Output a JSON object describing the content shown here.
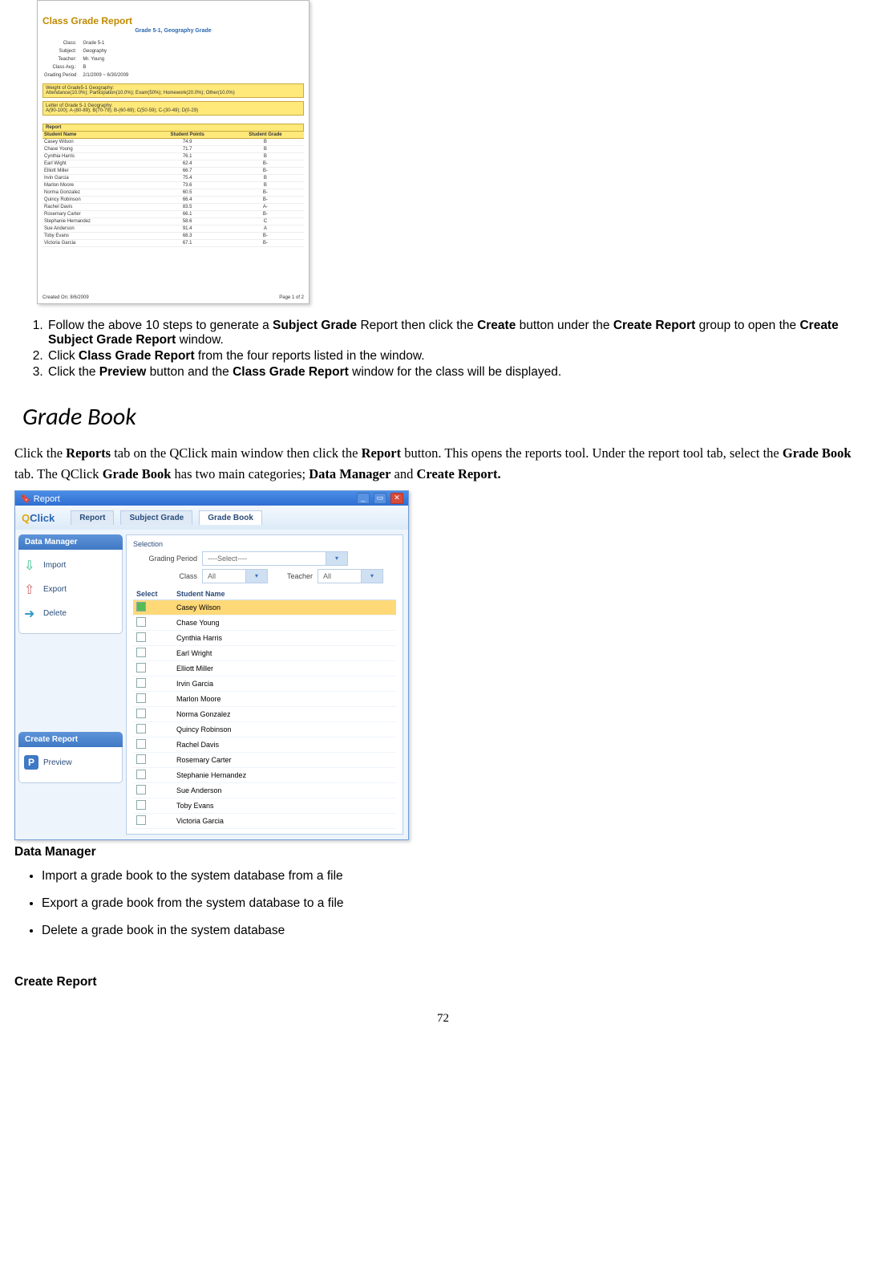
{
  "report": {
    "title": "Class Grade Report",
    "subtitle": "Grade 5-1, Geography Grade",
    "info": {
      "class_label": "Class:",
      "class_value": "Grade 5-1",
      "subject_label": "Subject:",
      "subject_value": "Geography",
      "teacher_label": "Teacher:",
      "teacher_value": "Mr. Young",
      "classavg_label": "Class Avg.:",
      "classavg_value": "B",
      "period_label": "Grading Period",
      "period_value": "2/1/2009 ~ 6/30/2009"
    },
    "weight_header": "Weight of Grade5-1 Geography:",
    "weight_text": "Attendance(10.0%); Participation(10.0%); Exam(50%); Homework(20.0%); Other(10.0%)",
    "letter_header": "Letter of Grade 5-1 Geography:",
    "letter_text": "A(90-100); A-(80-89); B(70-79); B-(60-69); C(50-59); C-(30-49); D(0-29)",
    "section_hdr": "Report",
    "cols": {
      "name": "Student Name",
      "points": "Student  Points",
      "grade": "Student Grade"
    },
    "rows": [
      {
        "name": "Casey Wilson",
        "points": "74.9",
        "grade": "B"
      },
      {
        "name": "Chase Young",
        "points": "71.7",
        "grade": "B"
      },
      {
        "name": "Cynthia Harris",
        "points": "76.1",
        "grade": "B"
      },
      {
        "name": "Earl Wight",
        "points": "62.4",
        "grade": "B-"
      },
      {
        "name": "Elliott Miller",
        "points": "66.7",
        "grade": "B-"
      },
      {
        "name": "Irvin Garcia",
        "points": "75.4",
        "grade": "B"
      },
      {
        "name": "Marlon Moore",
        "points": "73.6",
        "grade": "B"
      },
      {
        "name": "Norma Gonzalez",
        "points": "60.5",
        "grade": "B-"
      },
      {
        "name": "Quincy Robinson",
        "points": "66.4",
        "grade": "B-"
      },
      {
        "name": "Rachel Davis",
        "points": "83.5",
        "grade": "A-"
      },
      {
        "name": "Rosemary Carter",
        "points": "66.1",
        "grade": "B-"
      },
      {
        "name": "Stephanie Hernandez",
        "points": "58.6",
        "grade": "C"
      },
      {
        "name": "Sue Anderson",
        "points": "91.4",
        "grade": "A"
      },
      {
        "name": "Toby Evans",
        "points": "68.3",
        "grade": "B-"
      },
      {
        "name": "Victoria Garcia",
        "points": "67.1",
        "grade": "B-"
      }
    ],
    "created": "Created On:  8/6/2009",
    "page": "Page 1 of 2"
  },
  "steps": {
    "s1a": "Follow the above 10 steps to generate a ",
    "s1b": "Subject Grade",
    "s1c": " Report then click the ",
    "s1d": "Create",
    "s1e": " button under the ",
    "s1f": "Create Report",
    "s1g": " group to open the ",
    "s1h": "Create Subject Grade Report",
    "s1i": " window.",
    "s2a": "Click ",
    "s2b": "Class Grade Report",
    "s2c": " from the four reports listed in the window.",
    "s3a": "Click the ",
    "s3b": "Preview",
    "s3c": " button and the ",
    "s3d": "Class Grade Report",
    "s3e": " window for the class will be displayed."
  },
  "heading": "Grade Book",
  "para": {
    "p1a": "Click the ",
    "p1b": "Reports",
    "p1c": " tab on the QClick main window then click the ",
    "p1d": "Report",
    "p1e": " button. This opens the reports tool. Under the report tool tab, select the ",
    "p1f": "Grade Book",
    "p1g": " tab. The QClick ",
    "p1h": "Grade Book",
    "p1i": " has two main categories; ",
    "p1j": "Data Manager",
    "p1k": " and ",
    "p1l": "Create Report."
  },
  "qclick": {
    "title": "Report",
    "logo": "Click",
    "tabs": {
      "report": "Report",
      "subject": "Subject Grade",
      "grade": "Grade Book"
    },
    "side": {
      "dm_hdr": "Data Manager",
      "import": "Import",
      "export": "Export",
      "delete": "Delete",
      "cr_hdr": "Create Report",
      "preview": "Preview"
    },
    "sel": {
      "section": "Selection",
      "period_lbl": "Grading Period",
      "period_val": "----Select----",
      "class_lbl": "Class",
      "class_val": "All",
      "teacher_lbl": "Teacher",
      "teacher_val": "All",
      "select_hdr": "Select",
      "name_hdr": "Student Name"
    },
    "students": [
      {
        "name": "Casey Wilson",
        "sel": true
      },
      {
        "name": "Chase Young",
        "sel": false
      },
      {
        "name": "Cynthia Harris",
        "sel": false
      },
      {
        "name": "Earl Wright",
        "sel": false
      },
      {
        "name": "Elliott Miller",
        "sel": false
      },
      {
        "name": "Irvin Garcia",
        "sel": false
      },
      {
        "name": "Marlon Moore",
        "sel": false
      },
      {
        "name": "Norma Gonzalez",
        "sel": false
      },
      {
        "name": "Quincy Robinson",
        "sel": false
      },
      {
        "name": "Rachel Davis",
        "sel": false
      },
      {
        "name": "Rosemary Carter",
        "sel": false
      },
      {
        "name": "Stephanie Hernandez",
        "sel": false
      },
      {
        "name": "Sue Anderson",
        "sel": false
      },
      {
        "name": "Toby Evans",
        "sel": false
      },
      {
        "name": "Victoria Garcia",
        "sel": false
      }
    ]
  },
  "dm_heading": "Data Manager",
  "dm_items": {
    "i1": "Import a grade book to the system database from a file",
    "i2": "Export a grade book from the system database to a file",
    "i3": "Delete a grade book in the system database"
  },
  "cr_heading": "Create Report",
  "page_number": "72"
}
